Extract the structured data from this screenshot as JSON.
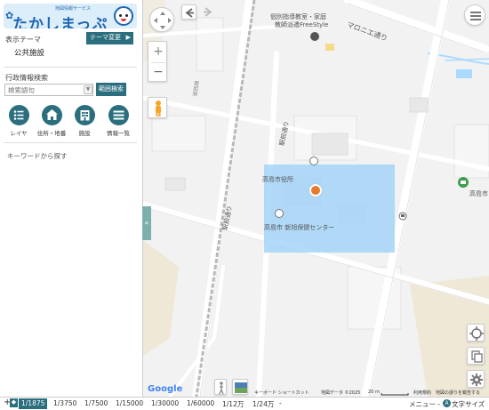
{
  "app": {
    "logo_subtitle": "地図情報サービス",
    "logo_title": "たかしまっぷ"
  },
  "sidebar": {
    "theme_label": "表示テーマ",
    "theme_change_button": "テーマ変更",
    "theme_value": "公共施設",
    "search_label": "行政情報検索",
    "search_placeholder": "検索語句",
    "range_search_button": "範囲検索",
    "tools": [
      {
        "label": "レイヤ",
        "icon": "layer-list-icon"
      },
      {
        "label": "住所・地番",
        "icon": "house-icon"
      },
      {
        "label": "施設",
        "icon": "building-icon"
      },
      {
        "label": "情報一覧",
        "icon": "list-icon"
      }
    ],
    "keyword_hint": "キーワードから探す",
    "collapse_tab": "«"
  },
  "map": {
    "labels": {
      "school": "個別指導教室・家庭",
      "school2": "教師派遣FreeStyle",
      "marone_street": "マロニエ通り",
      "city_hall": "高島市役所",
      "health_center": "高島市 新旭保健センター",
      "takashima_right": "高島市",
      "station_street": "駅前通り",
      "sub_street": "駅前通り",
      "rail_label": "湖西線"
    },
    "attribution": {
      "google": "Google",
      "shortcuts": "キーボード ショートカット",
      "map_data": "地図データ ©2025",
      "scale": "20 m",
      "terms": "利用規約",
      "report": "地図の誤りを報告する"
    }
  },
  "statusbar": {
    "scales": [
      "1/1875",
      "1/3750",
      "1/7500",
      "1/15000",
      "1/30000",
      "1/60000",
      "1/12万",
      "1/24万"
    ],
    "active_scale": "1/1875",
    "plus": "+",
    "minus": "-",
    "menu": "メニュー -",
    "text_size": "文字サイズ"
  },
  "colors": {
    "accent": "#2b6e7e",
    "highlight_area": "#9fd2f7"
  }
}
